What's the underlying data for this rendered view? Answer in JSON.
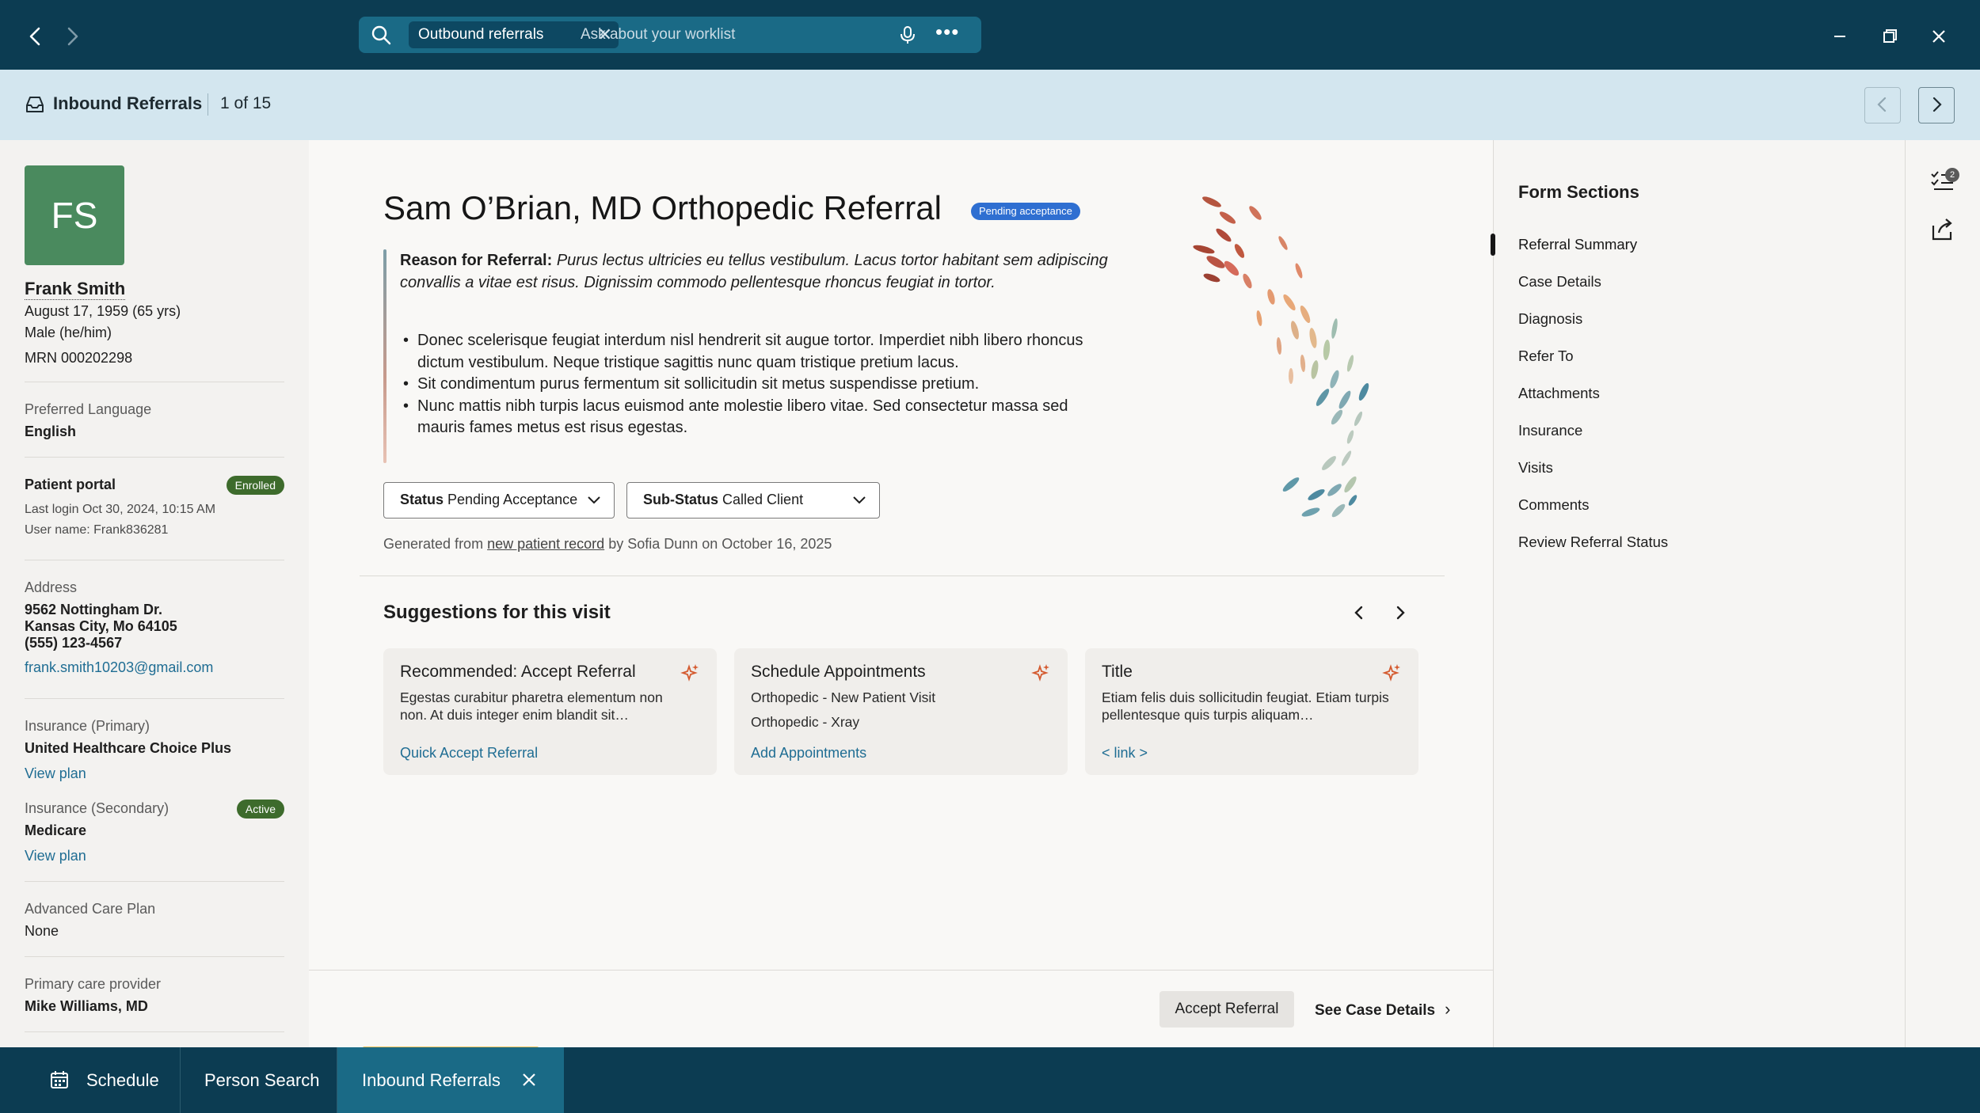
{
  "topbar": {
    "search_chip": "Outbound referrals",
    "search_placeholder": "Ask about your worklist"
  },
  "subheader": {
    "title": "Inbound Referrals",
    "count": "1 of 15"
  },
  "patient": {
    "initials": "FS",
    "name": "Frank Smith",
    "dob": "August 17, 1959 (65 yrs)",
    "sex": "Male (he/him)",
    "mrn": "MRN 000202298",
    "language_label": "Preferred Language",
    "language": "English",
    "portal_label": "Patient portal",
    "portal_badge": "Enrolled",
    "last_login": "Last login Oct 30, 2024, 10:15 AM",
    "username": "User name: Frank836281",
    "address_label": "Address",
    "address_line1": "9562 Nottingham Dr.",
    "address_line2": "Kansas City, Mo 64105",
    "phone": "(555) 123-4567",
    "email": "frank.smith10203@gmail.com",
    "ins_primary_label": "Insurance (Primary)",
    "ins_primary": "United Healthcare Choice Plus",
    "ins_primary_link": "View plan",
    "ins_secondary_label": "Insurance (Secondary)",
    "ins_secondary_badge": "Active",
    "ins_secondary": "Medicare",
    "ins_secondary_link": "View plan",
    "acp_label": "Advanced Care Plan",
    "acp": "None",
    "pcp_label": "Primary care provider",
    "pcp": "Mike Williams, MD"
  },
  "referral": {
    "title": "Sam O’Brian, MD Orthopedic Referral",
    "status_badge": "Pending acceptance",
    "reason_label": "Reason for Referral:",
    "reason_text": "Purus lectus ultricies eu tellus vestibulum. Lacus tortor habitant sem adipiscing convallis a vitae est risus. Dignissim commodo pellentesque rhoncus feugiat in tortor.",
    "bullets": [
      "Donec scelerisque feugiat interdum nisl hendrerit sit augue tortor. Imperdiet nibh libero rhoncus dictum vestibulum. Neque tristique sagittis nunc quam tristique pretium lacus.",
      "Sit condimentum purus fermentum sit sollicitudin sit metus suspendisse pretium.",
      "Nunc mattis nibh turpis lacus euismod ante molestie libero vitae. Sed consectetur massa sed mauris fames metus est risus egestas."
    ],
    "status_key": "Status",
    "status_value": "Pending Acceptance",
    "substatus_key": "Sub-Status",
    "substatus_value": "Called Client",
    "generated_prefix": "Generated from",
    "generated_link": "new patient record",
    "generated_suffix": "by Sofia Dunn on October 16, 2025"
  },
  "suggestions": {
    "title": "Suggestions for this visit",
    "cards": [
      {
        "title": "Recommended: Accept Referral",
        "body": "Egestas curabitur pharetra elementum non non. At duis integer enim blandit sit…",
        "link": "Quick Accept Referral"
      },
      {
        "title": "Schedule Appointments",
        "line1": "Orthopedic - New Patient Visit",
        "line2": "Orthopedic - Xray",
        "link": "Add Appointments"
      },
      {
        "title": "Title",
        "body": "Etiam felis duis sollicitudin feugiat. Etiam turpis pellentesque quis turpis aliquam…",
        "link": "< link >"
      }
    ]
  },
  "footer": {
    "accept": "Accept Referral",
    "see_case": "See Case Details"
  },
  "form_sections": {
    "title": "Form Sections",
    "items": [
      "Referral Summary",
      "Case Details",
      "Diagnosis",
      "Refer To",
      "Attachments",
      "Insurance",
      "Visits",
      "Comments",
      "Review Referral Status"
    ]
  },
  "toolstrip": {
    "checklist_badge": "2"
  },
  "tabs": [
    "Schedule",
    "Person Search",
    "Inbound Referrals"
  ],
  "colors": {
    "topbar": "#0c3c52",
    "accent": "#1a6a86",
    "subheader": "#d3e6ef",
    "badge_blue": "#2f6fd1",
    "badge_green": "#3d6b2c",
    "link": "#1f6d93"
  }
}
